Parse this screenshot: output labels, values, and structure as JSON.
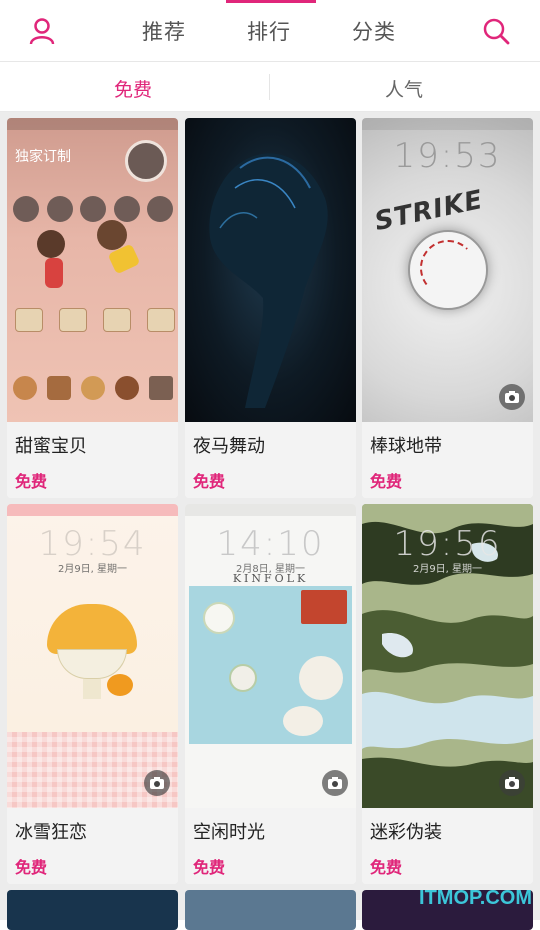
{
  "nav": {
    "tabs": [
      "推荐",
      "排行",
      "分类"
    ],
    "user_icon": "user-icon",
    "search_icon": "search-icon",
    "accent": "#e0267a"
  },
  "subtabs": {
    "free": "免费",
    "popular": "人气"
  },
  "cards": [
    {
      "name": "甜蜜宝贝",
      "price": "免费",
      "banner": "独家订制"
    },
    {
      "name": "夜马舞动",
      "price": "免费"
    },
    {
      "name": "棒球地带",
      "price": "免费",
      "time": "19:53",
      "art_text": "STRIKE"
    },
    {
      "name": "冰雪狂恋",
      "price": "免费",
      "time": "19:54",
      "date": "2月9日, 星期一"
    },
    {
      "name": "空闲时光",
      "price": "免费",
      "time": "14:10",
      "date": "2月8日, 星期一",
      "brand": "KINFOLK"
    },
    {
      "name": "迷彩伪装",
      "price": "免费",
      "time": "19:56",
      "date": "2月9日, 星期一"
    }
  ],
  "watermark": "ITMOP.COM"
}
